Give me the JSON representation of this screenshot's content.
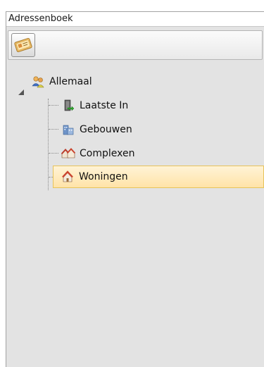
{
  "panel": {
    "title": "Adressenboek"
  },
  "toolbar": {
    "buttons": [
      {
        "icon": "address-card-icon"
      }
    ]
  },
  "tree": {
    "root": {
      "label": "Allemaal",
      "icon": "people-icon",
      "expanded": true
    },
    "children": [
      {
        "label": "Laatste In",
        "icon": "door-in-icon",
        "selected": false
      },
      {
        "label": "Gebouwen",
        "icon": "buildings-icon",
        "selected": false
      },
      {
        "label": "Complexen",
        "icon": "houses-icon",
        "selected": false
      },
      {
        "label": "Woningen",
        "icon": "house-icon",
        "selected": true
      }
    ]
  },
  "colors": {
    "selection_background": "#ffe3a8",
    "selection_border": "#e7c35a",
    "panel_background": "#e3e3e3"
  }
}
